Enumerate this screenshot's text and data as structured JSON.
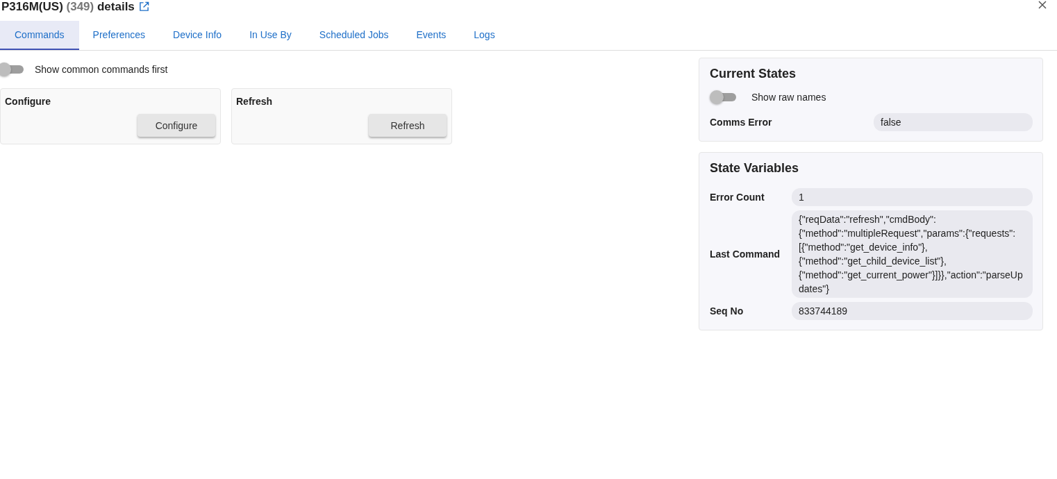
{
  "header": {
    "device": "P316M(US)",
    "id": "(349)",
    "suffix": "details"
  },
  "tabs": [
    {
      "label": "Commands",
      "selected": true
    },
    {
      "label": "Preferences",
      "selected": false
    },
    {
      "label": "Device Info",
      "selected": false
    },
    {
      "label": "In Use By",
      "selected": false
    },
    {
      "label": "Scheduled Jobs",
      "selected": false
    },
    {
      "label": "Events",
      "selected": false
    },
    {
      "label": "Logs",
      "selected": false
    }
  ],
  "common_toggle": {
    "label": "Show common commands first",
    "on": false
  },
  "commands": [
    {
      "title": "Configure",
      "button": "Configure"
    },
    {
      "title": "Refresh",
      "button": "Refresh"
    }
  ],
  "current_states": {
    "title": "Current States",
    "raw_toggle": {
      "label": "Show raw names",
      "on": false
    },
    "rows": [
      {
        "name": "Comms Error",
        "value": "false"
      }
    ]
  },
  "state_variables": {
    "title": "State Variables",
    "rows": [
      {
        "name": "Error Count",
        "value": "1"
      },
      {
        "name": "Last Command",
        "value": "{\"reqData\":\"refresh\",\"cmdBody\":{\"method\":\"multipleRequest\",\"params\":{\"requests\":[{\"method\":\"get_device_info\"},{\"method\":\"get_child_device_list\"},{\"method\":\"get_current_power\"}]}},\"action\":\"parseUpdates\"}"
      },
      {
        "name": "Seq No",
        "value": "833744189"
      }
    ]
  }
}
